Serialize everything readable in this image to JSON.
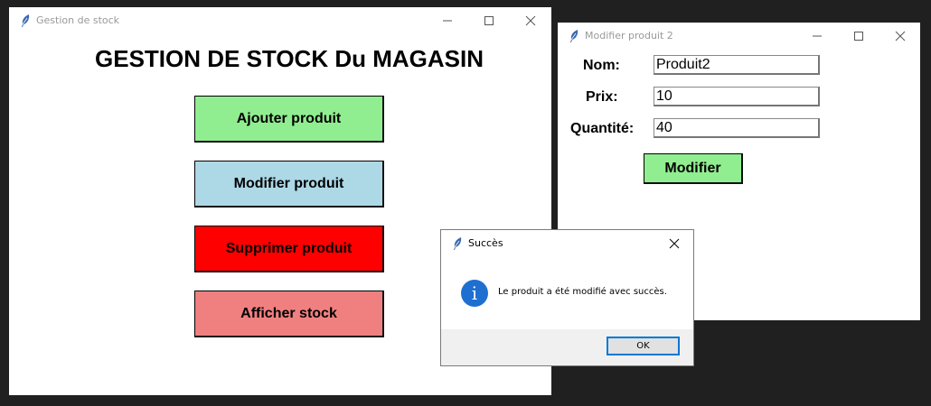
{
  "main_window": {
    "title": "Gestion de stock",
    "heading": "GESTION DE STOCK Du MAGASIN",
    "buttons": [
      {
        "label": "Ajouter produit",
        "color": "#90ee90"
      },
      {
        "label": "Modifier produit",
        "color": "#add8e6"
      },
      {
        "label": "Supprimer produit",
        "color": "#ff0000"
      },
      {
        "label": "Afficher stock",
        "color": "#f08080"
      }
    ]
  },
  "modify_window": {
    "title": "Modifier produit 2",
    "fields": [
      {
        "label": "Nom:",
        "value": "Produit2"
      },
      {
        "label": "Prix:",
        "value": "10"
      },
      {
        "label": "Quantité:",
        "value": "40"
      }
    ],
    "submit_label": "Modifier",
    "submit_color": "#90ee90"
  },
  "success_dialog": {
    "title": "Succès",
    "icon": "info-icon",
    "message": "Le produit a été modifié avec succès.",
    "ok_label": "OK"
  }
}
